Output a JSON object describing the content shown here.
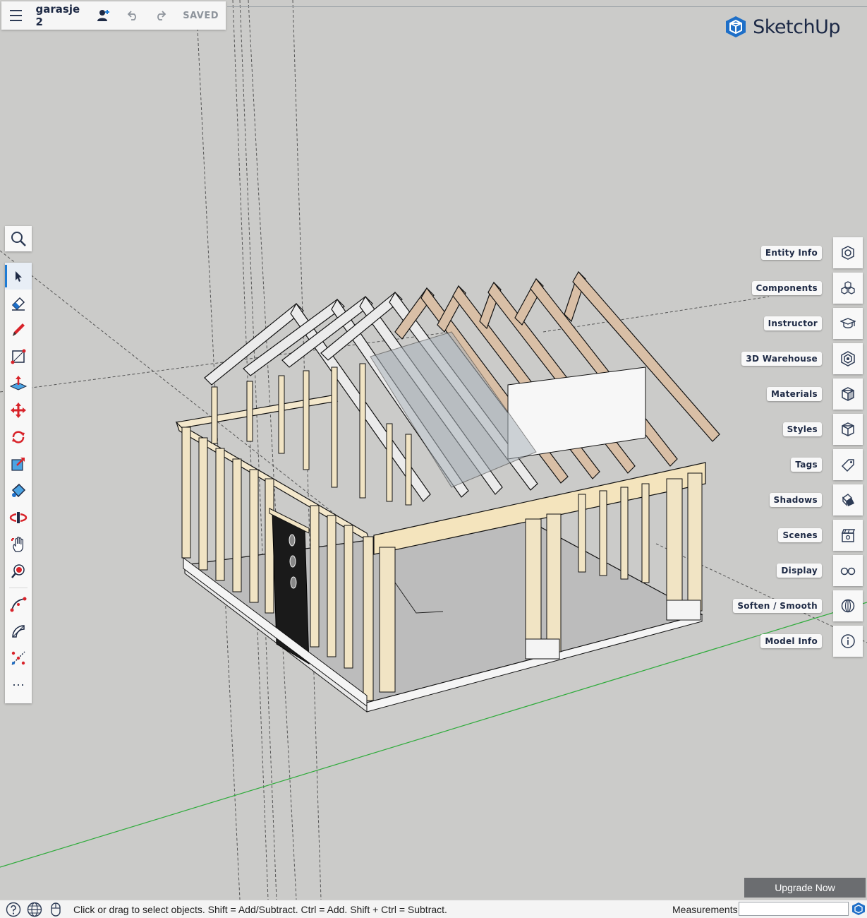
{
  "app": {
    "brand": "SketchUp"
  },
  "topbar": {
    "title": "garasje 2",
    "saved": "SAVED"
  },
  "toolbar": {
    "search": "search-icon",
    "tools": [
      "select-tool",
      "eraser-tool",
      "pencil-tool",
      "rectangle-tool",
      "push-pull-tool",
      "move-tool",
      "rotate-tool",
      "scale-tool",
      "paint-bucket-tool",
      "orbit-tool",
      "pan-tool",
      "zoom-tool",
      "arc-tool",
      "protractor-tool",
      "tape-measure-tool",
      "more-tools"
    ],
    "more": "⋯"
  },
  "panels": [
    {
      "label": "Entity Info",
      "icon": "entity-info-icon"
    },
    {
      "label": "Components",
      "icon": "components-icon"
    },
    {
      "label": "Instructor",
      "icon": "instructor-icon"
    },
    {
      "label": "3D Warehouse",
      "icon": "warehouse-icon"
    },
    {
      "label": "Materials",
      "icon": "materials-icon"
    },
    {
      "label": "Styles",
      "icon": "styles-icon"
    },
    {
      "label": "Tags",
      "icon": "tags-icon"
    },
    {
      "label": "Shadows",
      "icon": "shadows-icon"
    },
    {
      "label": "Scenes",
      "icon": "scenes-icon"
    },
    {
      "label": "Display",
      "icon": "display-icon"
    },
    {
      "label": "Soften / Smooth",
      "icon": "soften-icon"
    },
    {
      "label": "Model Info",
      "icon": "model-info-icon"
    }
  ],
  "upgrade": {
    "label": "Upgrade Now"
  },
  "status": {
    "hint": "Click or drag to select objects. Shift = Add/Subtract. Ctrl = Add. Shift + Ctrl = Subtract.",
    "measurements_label": "Measurements",
    "measurements_value": ""
  },
  "colors": {
    "background": "#cbcbc9",
    "stud": "#f1e4c4",
    "truss_white": "#ebebeb",
    "truss_wood": "#d9bfa6",
    "floor": "#bcbcbc",
    "axis_green": "#2eab3a"
  }
}
